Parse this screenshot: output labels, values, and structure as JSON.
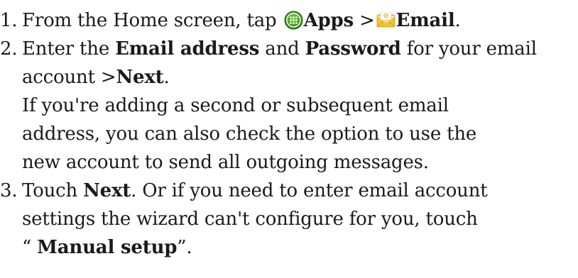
{
  "clipped_heading": "",
  "steps": [
    {
      "number": "1.",
      "text_before": "From the Home screen, tap ",
      "apps_label": "Apps",
      "separator": " >",
      "email_label": "Email",
      "period": ".",
      "icons": [
        "apps-icon",
        "email-icon"
      ]
    },
    {
      "number": "2.",
      "t1": "Enter the ",
      "email_address": "Email address",
      "t2": " and ",
      "password": "Password",
      "t3": " for your email",
      "line2_text": "account >",
      "next_label": "Next",
      "line2_end": ".",
      "note_lines": [
        "If you're adding a second or subsequent email",
        "address, you can also check the option to use the",
        "new account to send all outgoing messages."
      ]
    },
    {
      "number": "3.",
      "t1": "Touch ",
      "next_label": "Next",
      "t2": ". Or if you need to enter email account",
      "line2": "settings the wizard can't configure for you, touch",
      "open_quote": "“ ",
      "manual_setup": "Manual setup",
      "close_quote": "”."
    }
  ],
  "colors": {
    "text": "#1a1a1a",
    "apps_icon_green": "#3a8a1e",
    "email_icon_yellow": "#f2c230"
  }
}
